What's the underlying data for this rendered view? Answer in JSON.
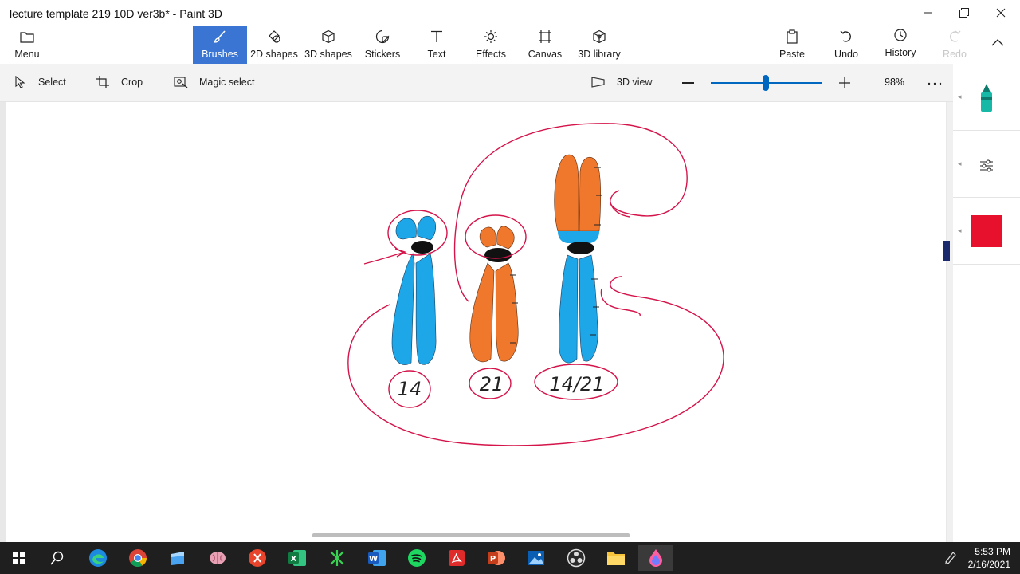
{
  "window": {
    "title": "lecture template 219 10D ver3b* - Paint 3D",
    "controls": [
      "minimize-icon",
      "restore-icon",
      "close-icon"
    ]
  },
  "ribbon": {
    "menu_label": "Menu",
    "tabs": [
      {
        "label": "Brushes",
        "icon": "brush-icon",
        "active": true
      },
      {
        "label": "2D shapes",
        "icon": "2d-shapes-icon"
      },
      {
        "label": "3D shapes",
        "icon": "3d-shapes-icon"
      },
      {
        "label": "Stickers",
        "icon": "stickers-icon"
      },
      {
        "label": "Text",
        "icon": "text-icon"
      },
      {
        "label": "Effects",
        "icon": "effects-icon"
      },
      {
        "label": "Canvas",
        "icon": "canvas-icon"
      },
      {
        "label": "3D library",
        "icon": "3d-library-icon"
      }
    ],
    "paste_label": "Paste",
    "undo_label": "Undo",
    "history_label": "History",
    "redo_label": "Redo"
  },
  "toolbar": {
    "select_label": "Select",
    "crop_label": "Crop",
    "magic_select_label": "Magic select",
    "view3d_label": "3D view",
    "zoom_percent": "98%",
    "zoom_level": 0.49
  },
  "drawing": {
    "labels": [
      "14",
      "21",
      "14/21"
    ],
    "colors": {
      "blue": "#1ea7e8",
      "orange": "#f0782c",
      "red": "#d4144a",
      "black": "#111111"
    }
  },
  "side_panel": {
    "selected_color": "#e8112d",
    "items": [
      "marker-icon",
      "adjust-icon",
      "color-swatch"
    ]
  },
  "taskbar": {
    "time": "5:53 PM",
    "date": "2/16/2021",
    "apps": [
      "windows-start-icon",
      "search-icon",
      "edge-icon",
      "chrome-icon",
      "files-icon",
      "paint-brain-icon",
      "remote-icon",
      "excel-icon",
      "dev-icon",
      "word-icon",
      "spotify-icon",
      "acrobat-icon",
      "powerpoint-icon",
      "photos-icon",
      "obs-icon",
      "file-explorer-icon",
      "paint3d-icon"
    ]
  }
}
